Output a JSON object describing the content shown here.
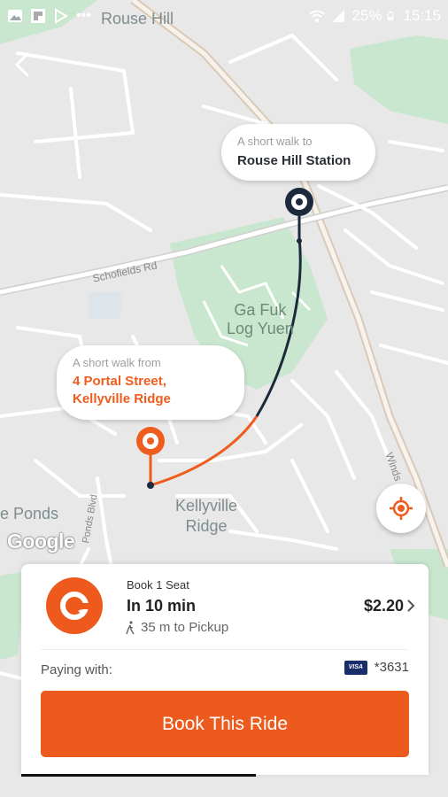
{
  "status_bar": {
    "battery": "25%",
    "time": "15:15",
    "left_icons": [
      "gallery-icon",
      "flipboard-icon",
      "play-store-icon",
      "more-dots-icon"
    ],
    "right_icons": [
      "wifi-icon",
      "signal-icon",
      "battery-icon"
    ]
  },
  "map": {
    "labels": {
      "rouse_hill": "Rouse Hill",
      "schofields_rd": "Schofields Rd",
      "park": "Ga Fuk\nLog Yuen",
      "kellyville_ridge": "Kellyville\nRidge",
      "ponds": "e Ponds",
      "windsor": "Winds",
      "ponds_blvd": "Ponds Blvd"
    },
    "google_attribution": "Google",
    "colors": {
      "route_dark": "#1d2a3d",
      "route_orange": "#ef5d1e",
      "park": "#c9e7cf"
    }
  },
  "destination_bubble": {
    "subtitle": "A short walk to",
    "title": "Rouse Hill Station"
  },
  "pickup_bubble": {
    "subtitle": "A short walk from",
    "title_line1": "4 Portal Street,",
    "title_line2": "Kellyville Ridge"
  },
  "ride_card": {
    "seat_label": "Book 1 Seat",
    "eta": "In 10 min",
    "walk_distance": "35 m to Pickup",
    "price": "$2.20",
    "paying_label": "Paying with:",
    "card_brand": "VISA",
    "card_number": "*3631",
    "book_button": "Book This Ride",
    "accent_color": "#ec5a1d"
  }
}
